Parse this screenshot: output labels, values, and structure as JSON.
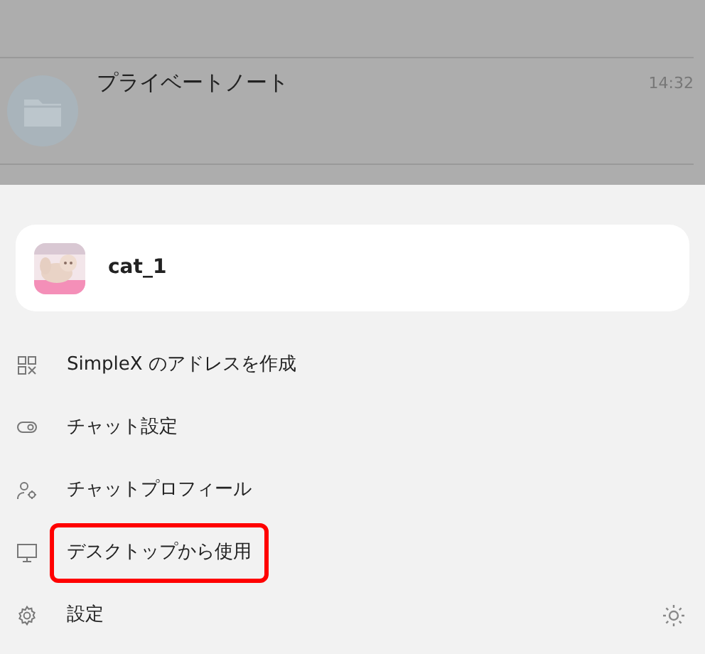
{
  "chat_list": [
    {
      "title": "プライベートノート",
      "time": "14:32"
    }
  ],
  "profile": {
    "name": "cat_1"
  },
  "menu": [
    {
      "kind": "qr",
      "label": "SimpleX のアドレスを作成",
      "highlighted": false
    },
    {
      "kind": "toggle",
      "label": "チャット設定",
      "highlighted": false
    },
    {
      "kind": "person-gear",
      "label": "チャットプロフィール",
      "highlighted": false
    },
    {
      "kind": "monitor",
      "label": "デスクトップから使用",
      "highlighted": true
    },
    {
      "kind": "gear",
      "label": "設定",
      "highlighted": false
    }
  ]
}
